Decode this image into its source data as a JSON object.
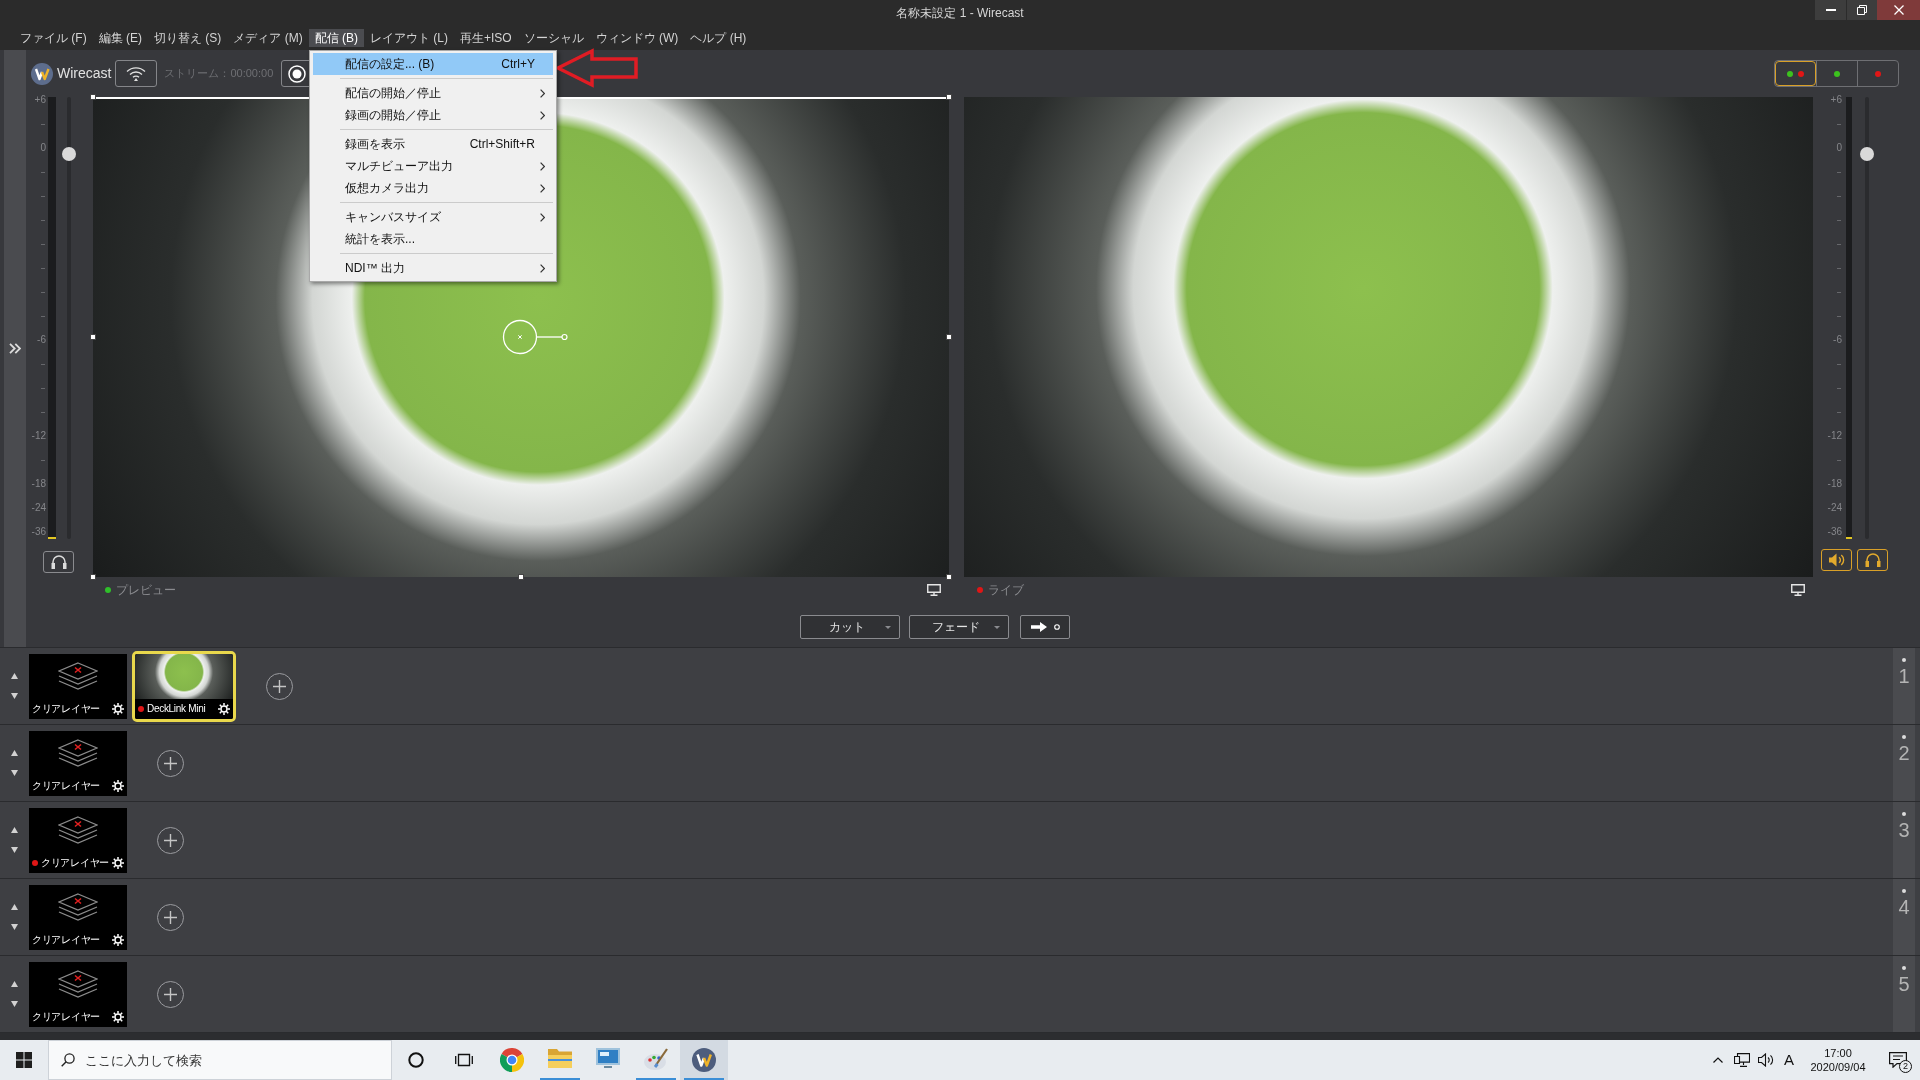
{
  "window": {
    "title": "名称未設定 1 - Wirecast"
  },
  "menu_bar": [
    {
      "label": "ファイル (F)",
      "selected": false
    },
    {
      "label": "編集 (E)",
      "selected": false
    },
    {
      "label": "切り替え (S)",
      "selected": false
    },
    {
      "label": "メディア (M)",
      "selected": false
    },
    {
      "label": "配信 (B)",
      "selected": true
    },
    {
      "label": "レイアウト (L)",
      "selected": false
    },
    {
      "label": "再生+ISO",
      "selected": false
    },
    {
      "label": "ソーシャル",
      "selected": false
    },
    {
      "label": "ウィンドウ (W)",
      "selected": false
    },
    {
      "label": "ヘルプ (H)",
      "selected": false
    }
  ],
  "toolbar": {
    "app_name": "Wirecast",
    "stream_status": "ストリーム：00:00:00"
  },
  "dropdown_menu": [
    {
      "kind": "item",
      "label": "配信の設定... (B)",
      "shortcut": "Ctrl+Y",
      "selected": true
    },
    {
      "kind": "separator"
    },
    {
      "kind": "submenu",
      "label": "配信の開始／停止",
      "selected": false
    },
    {
      "kind": "submenu",
      "label": "録画の開始／停止",
      "selected": false
    },
    {
      "kind": "separator"
    },
    {
      "kind": "item",
      "label": "録画を表示",
      "shortcut": "Ctrl+Shift+R",
      "selected": false
    },
    {
      "kind": "submenu",
      "label": "マルチビューア出力",
      "selected": false
    },
    {
      "kind": "submenu",
      "label": "仮想カメラ出力",
      "selected": false
    },
    {
      "kind": "separator"
    },
    {
      "kind": "submenu",
      "label": "キャンバスサイズ",
      "selected": false
    },
    {
      "kind": "item",
      "label": "統計を表示...",
      "selected": false
    },
    {
      "kind": "separator"
    },
    {
      "kind": "submenu",
      "label": "NDI™ 出力",
      "selected": false
    }
  ],
  "layout_modes": [
    {
      "selected": true,
      "dots": [
        {
          "color": "#3cc21e"
        },
        {
          "color": "#e01616"
        }
      ]
    },
    {
      "selected": false,
      "dots": [
        {
          "color": "#3cc21e"
        }
      ]
    },
    {
      "selected": false,
      "dots": [
        {
          "color": "#e01616"
        }
      ]
    }
  ],
  "preview": {
    "label": "プレビュー",
    "meter_scale": [
      "+6",
      "0",
      "-6",
      "-12",
      "-18",
      "-24",
      "-36"
    ],
    "fader": {
      "level": 0.87
    },
    "headphones": {
      "on": false
    }
  },
  "live": {
    "label": "ライブ",
    "meter_scale": [
      "+6",
      "0",
      "-6",
      "-12",
      "-18",
      "-24",
      "-36"
    ],
    "fader": {
      "level": 0.87
    },
    "speaker": {
      "on": true
    },
    "headphones": {
      "on": true
    }
  },
  "transitions": [
    {
      "label": "カット"
    },
    {
      "label": "フェード"
    }
  ],
  "layers": [
    {
      "number": "1",
      "shots": [
        {
          "kind": "clear",
          "label": "クリアレイヤー",
          "live": false,
          "selected": false
        },
        {
          "kind": "camera",
          "label": "DeckLink Mini",
          "live": true,
          "selected": true
        }
      ]
    },
    {
      "number": "2",
      "shots": [
        {
          "kind": "clear",
          "label": "クリアレイヤー",
          "live": false,
          "selected": false
        }
      ]
    },
    {
      "number": "3",
      "shots": [
        {
          "kind": "clear",
          "label": "クリアレイヤー",
          "live": true,
          "selected": false
        }
      ]
    },
    {
      "number": "4",
      "shots": [
        {
          "kind": "clear",
          "label": "クリアレイヤー",
          "live": false,
          "selected": false
        }
      ]
    },
    {
      "number": "5",
      "shots": [
        {
          "kind": "clear",
          "label": "クリアレイヤー",
          "live": false,
          "selected": false
        }
      ]
    }
  ],
  "taskbar": {
    "search_placeholder": "ここに入力して検索",
    "apps": [
      {
        "kind": "browser",
        "running": false,
        "selected": false
      },
      {
        "kind": "folder",
        "running": true,
        "selected": false
      },
      {
        "kind": "display",
        "running": false,
        "selected": false
      },
      {
        "kind": "paint",
        "running": true,
        "selected": false
      },
      {
        "kind": "w-logo",
        "running": true,
        "selected": true
      }
    ],
    "ime": "A",
    "time": "17:00",
    "date": "2020/09/04",
    "notification_count": "2"
  }
}
